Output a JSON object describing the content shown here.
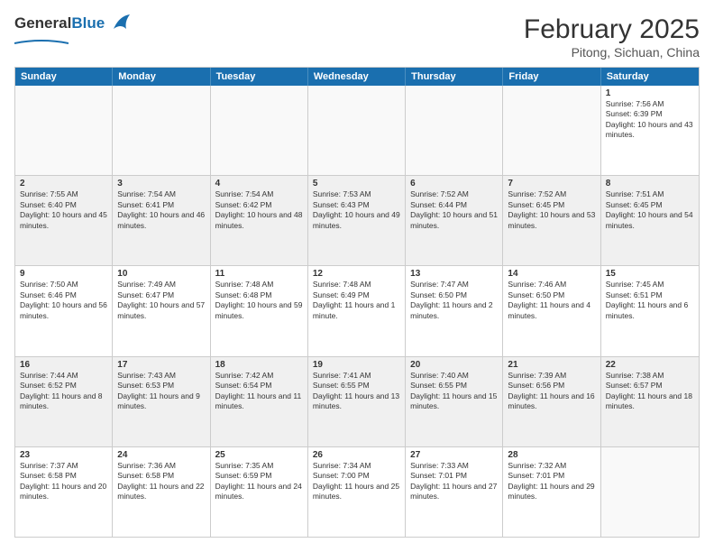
{
  "header": {
    "logo_general": "General",
    "logo_blue": "Blue",
    "month_year": "February 2025",
    "location": "Pitong, Sichuan, China"
  },
  "days_of_week": [
    "Sunday",
    "Monday",
    "Tuesday",
    "Wednesday",
    "Thursday",
    "Friday",
    "Saturday"
  ],
  "weeks": [
    [
      {
        "day": "",
        "text": "",
        "empty": true
      },
      {
        "day": "",
        "text": "",
        "empty": true
      },
      {
        "day": "",
        "text": "",
        "empty": true
      },
      {
        "day": "",
        "text": "",
        "empty": true
      },
      {
        "day": "",
        "text": "",
        "empty": true
      },
      {
        "day": "",
        "text": "",
        "empty": true
      },
      {
        "day": "1",
        "text": "Sunrise: 7:56 AM\nSunset: 6:39 PM\nDaylight: 10 hours and 43 minutes."
      }
    ],
    [
      {
        "day": "2",
        "text": "Sunrise: 7:55 AM\nSunset: 6:40 PM\nDaylight: 10 hours and 45 minutes."
      },
      {
        "day": "3",
        "text": "Sunrise: 7:54 AM\nSunset: 6:41 PM\nDaylight: 10 hours and 46 minutes."
      },
      {
        "day": "4",
        "text": "Sunrise: 7:54 AM\nSunset: 6:42 PM\nDaylight: 10 hours and 48 minutes."
      },
      {
        "day": "5",
        "text": "Sunrise: 7:53 AM\nSunset: 6:43 PM\nDaylight: 10 hours and 49 minutes."
      },
      {
        "day": "6",
        "text": "Sunrise: 7:52 AM\nSunset: 6:44 PM\nDaylight: 10 hours and 51 minutes."
      },
      {
        "day": "7",
        "text": "Sunrise: 7:52 AM\nSunset: 6:45 PM\nDaylight: 10 hours and 53 minutes."
      },
      {
        "day": "8",
        "text": "Sunrise: 7:51 AM\nSunset: 6:45 PM\nDaylight: 10 hours and 54 minutes."
      }
    ],
    [
      {
        "day": "9",
        "text": "Sunrise: 7:50 AM\nSunset: 6:46 PM\nDaylight: 10 hours and 56 minutes."
      },
      {
        "day": "10",
        "text": "Sunrise: 7:49 AM\nSunset: 6:47 PM\nDaylight: 10 hours and 57 minutes."
      },
      {
        "day": "11",
        "text": "Sunrise: 7:48 AM\nSunset: 6:48 PM\nDaylight: 10 hours and 59 minutes."
      },
      {
        "day": "12",
        "text": "Sunrise: 7:48 AM\nSunset: 6:49 PM\nDaylight: 11 hours and 1 minute."
      },
      {
        "day": "13",
        "text": "Sunrise: 7:47 AM\nSunset: 6:50 PM\nDaylight: 11 hours and 2 minutes."
      },
      {
        "day": "14",
        "text": "Sunrise: 7:46 AM\nSunset: 6:50 PM\nDaylight: 11 hours and 4 minutes."
      },
      {
        "day": "15",
        "text": "Sunrise: 7:45 AM\nSunset: 6:51 PM\nDaylight: 11 hours and 6 minutes."
      }
    ],
    [
      {
        "day": "16",
        "text": "Sunrise: 7:44 AM\nSunset: 6:52 PM\nDaylight: 11 hours and 8 minutes."
      },
      {
        "day": "17",
        "text": "Sunrise: 7:43 AM\nSunset: 6:53 PM\nDaylight: 11 hours and 9 minutes."
      },
      {
        "day": "18",
        "text": "Sunrise: 7:42 AM\nSunset: 6:54 PM\nDaylight: 11 hours and 11 minutes."
      },
      {
        "day": "19",
        "text": "Sunrise: 7:41 AM\nSunset: 6:55 PM\nDaylight: 11 hours and 13 minutes."
      },
      {
        "day": "20",
        "text": "Sunrise: 7:40 AM\nSunset: 6:55 PM\nDaylight: 11 hours and 15 minutes."
      },
      {
        "day": "21",
        "text": "Sunrise: 7:39 AM\nSunset: 6:56 PM\nDaylight: 11 hours and 16 minutes."
      },
      {
        "day": "22",
        "text": "Sunrise: 7:38 AM\nSunset: 6:57 PM\nDaylight: 11 hours and 18 minutes."
      }
    ],
    [
      {
        "day": "23",
        "text": "Sunrise: 7:37 AM\nSunset: 6:58 PM\nDaylight: 11 hours and 20 minutes."
      },
      {
        "day": "24",
        "text": "Sunrise: 7:36 AM\nSunset: 6:58 PM\nDaylight: 11 hours and 22 minutes."
      },
      {
        "day": "25",
        "text": "Sunrise: 7:35 AM\nSunset: 6:59 PM\nDaylight: 11 hours and 24 minutes."
      },
      {
        "day": "26",
        "text": "Sunrise: 7:34 AM\nSunset: 7:00 PM\nDaylight: 11 hours and 25 minutes."
      },
      {
        "day": "27",
        "text": "Sunrise: 7:33 AM\nSunset: 7:01 PM\nDaylight: 11 hours and 27 minutes."
      },
      {
        "day": "28",
        "text": "Sunrise: 7:32 AM\nSunset: 7:01 PM\nDaylight: 11 hours and 29 minutes."
      },
      {
        "day": "",
        "text": "",
        "empty": true
      }
    ]
  ]
}
